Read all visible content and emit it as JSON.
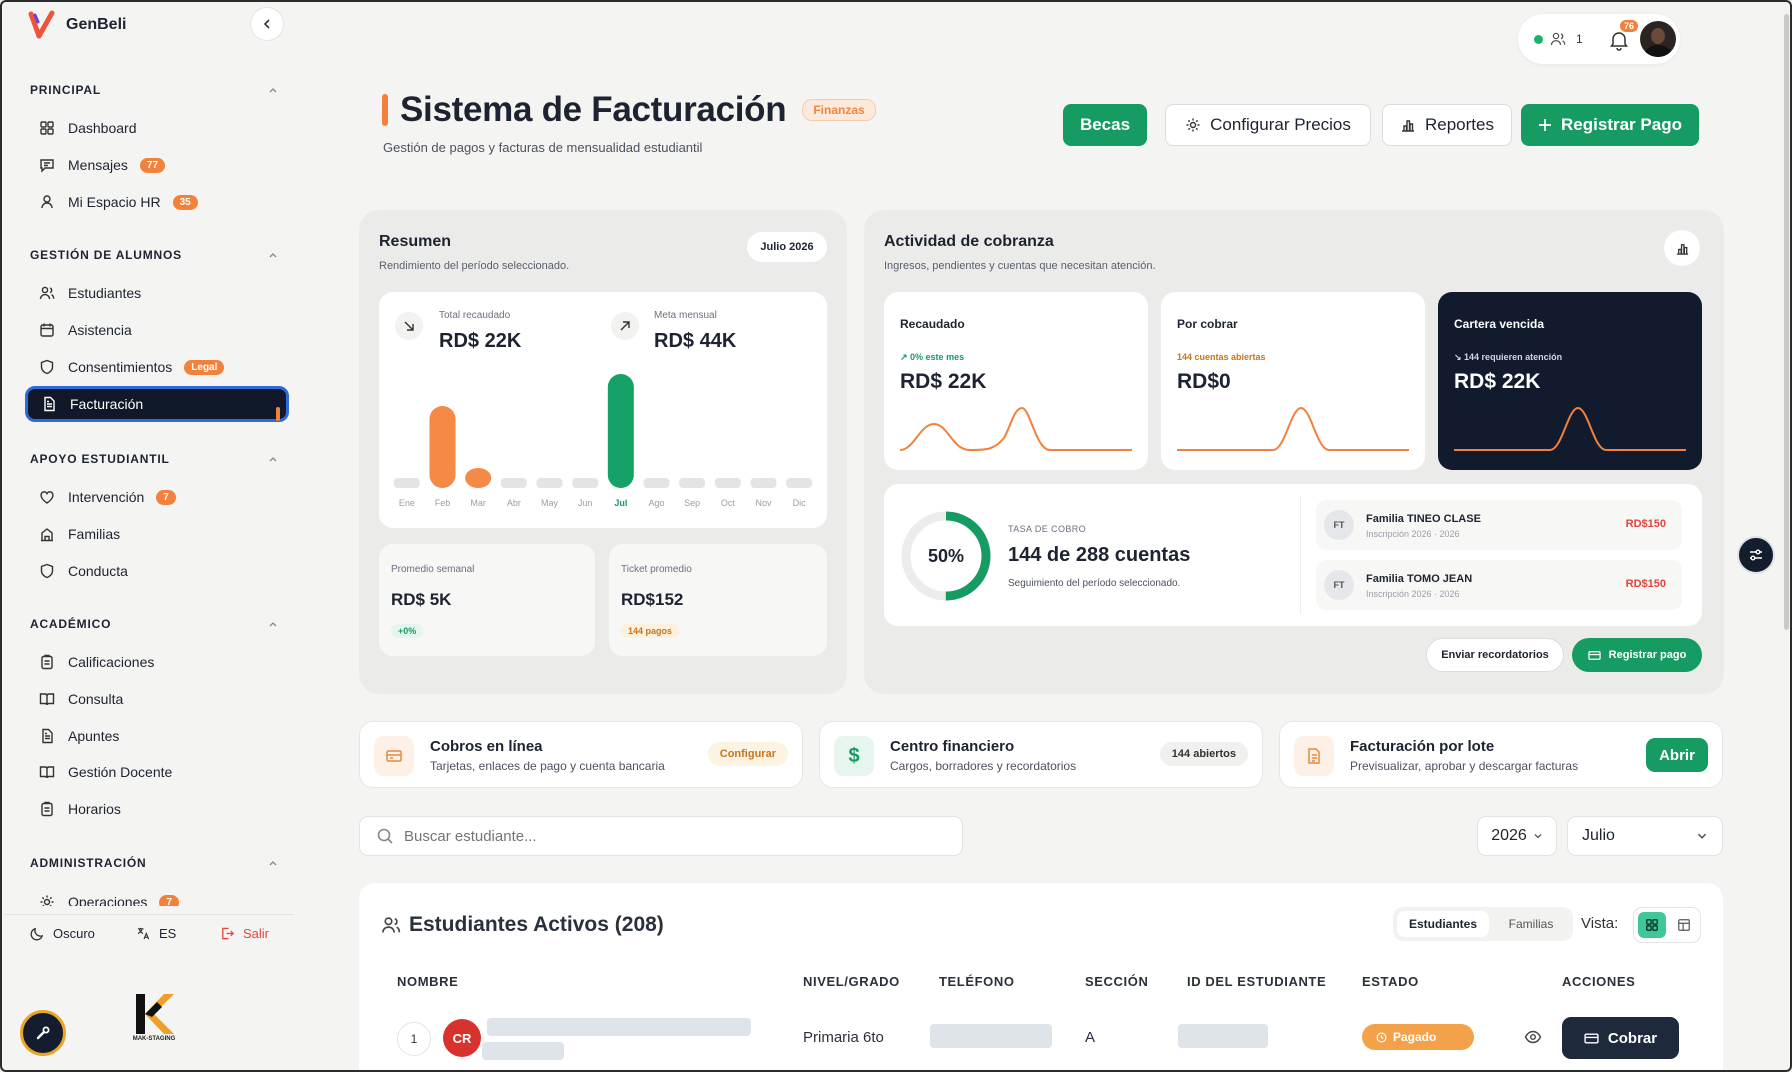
{
  "brand": {
    "name": "GenBeli"
  },
  "sidebar": {
    "sections": [
      {
        "title": "PRINCIPAL",
        "items": [
          {
            "label": "Dashboard",
            "icon": "grid-icon"
          },
          {
            "label": "Mensajes",
            "icon": "message-icon",
            "badge": "77"
          },
          {
            "label": "Mi Espacio HR",
            "icon": "user-icon",
            "badge": "35"
          }
        ]
      },
      {
        "title": "GESTIÓN DE ALUMNOS",
        "items": [
          {
            "label": "Estudiantes",
            "icon": "users-icon"
          },
          {
            "label": "Asistencia",
            "icon": "calendar-icon"
          },
          {
            "label": "Consentimientos",
            "icon": "shield-icon",
            "badge": "Legal"
          },
          {
            "label": "Facturación",
            "icon": "document-icon",
            "active": true
          }
        ]
      },
      {
        "title": "APOYO ESTUDIANTIL",
        "items": [
          {
            "label": "Intervención",
            "icon": "heart-icon",
            "badge": "7"
          },
          {
            "label": "Familias",
            "icon": "building-icon"
          },
          {
            "label": "Conducta",
            "icon": "shield-icon"
          }
        ]
      },
      {
        "title": "ACADÉMICO",
        "items": [
          {
            "label": "Calificaciones",
            "icon": "clipboard-icon"
          },
          {
            "label": "Consulta",
            "icon": "book-icon"
          },
          {
            "label": "Apuntes",
            "icon": "document-icon"
          },
          {
            "label": "Gestión Docente",
            "icon": "book-icon"
          },
          {
            "label": "Horarios",
            "icon": "clipboard-icon"
          }
        ]
      },
      {
        "title": "ADMINISTRACIÓN",
        "items": [
          {
            "label": "Operaciones",
            "icon": "gear-icon",
            "badge": "7"
          }
        ]
      }
    ],
    "footer": {
      "theme": "Oscuro",
      "lang": "ES",
      "logout": "Salir"
    },
    "studio": "MAK-STAGING"
  },
  "topbar": {
    "online_count": "1",
    "notifications": "76"
  },
  "header": {
    "title": "Sistema de Facturación",
    "tag": "Finanzas",
    "subtitle": "Gestión de pagos y facturas de mensualidad estudiantil",
    "buttons": {
      "becas": "Becas",
      "config": "Configurar Precios",
      "reportes": "Reportes",
      "registrar": "Registrar Pago"
    }
  },
  "resumen": {
    "title": "Resumen",
    "subtitle": "Rendimiento del período seleccionado.",
    "period": "Julio 2026",
    "total_label": "Total recaudado",
    "total_value": "RD$ 22K",
    "meta_label": "Meta mensual",
    "meta_value": "RD$ 44K",
    "promedio_label": "Promedio semanal",
    "promedio_value": "RD$ 5K",
    "promedio_delta": "+0%",
    "ticket_label": "Ticket promedio",
    "ticket_value": "RD$152",
    "ticket_count": "144 pagos"
  },
  "chart_data": {
    "type": "bar",
    "categories": [
      "Ene",
      "Feb",
      "Mar",
      "Abr",
      "May",
      "Jun",
      "Jul",
      "Ago",
      "Sep",
      "Oct",
      "Nov",
      "Dic"
    ],
    "values": [
      0,
      1,
      0.24,
      0,
      0,
      0,
      1.39,
      0,
      0,
      0,
      0,
      0
    ],
    "highlight": "Jul",
    "colors": {
      "bar": "#f48a46",
      "highlight": "#16a167",
      "empty": "#e4e4e2"
    },
    "title": "",
    "xlabel": "",
    "ylabel": ""
  },
  "actividad": {
    "title": "Actividad de cobranza",
    "subtitle": "Ingresos, pendientes y cuentas que necesitan atención.",
    "cards": [
      {
        "label": "Recaudado",
        "note": "↗ 0% este mes",
        "value": "RD$ 22K",
        "dark": false,
        "note_color": "#169b62"
      },
      {
        "label": "Por cobrar",
        "note": "144 cuentas abiertas",
        "value": "RD$0",
        "dark": false,
        "note_color": "#c9741d"
      },
      {
        "label": "Cartera vencida",
        "note": "↘ 144 requieren atención",
        "value": "RD$ 22K",
        "dark": true,
        "note_color": "#cfd5e2"
      }
    ],
    "tasa_pct": "50%",
    "tasa_value": 0.5,
    "tasa_label": "TASA DE COBRO",
    "tasa_text": "144 de 288 cuentas",
    "tasa_sub": "Seguimiento del período seleccionado.",
    "familias": [
      {
        "initials": "FT",
        "name": "Familia TINEO CLASE",
        "sub": "Inscripción 2026 · 2026",
        "amount": "RD$150"
      },
      {
        "initials": "FT",
        "name": "Familia TOMO JEAN",
        "sub": "Inscripción 2026 · 2026",
        "amount": "RD$150"
      }
    ],
    "recordatorios": "Enviar recordatorios",
    "registrar": "Registrar pago"
  },
  "features": [
    {
      "title": "Cobros en línea",
      "sub": "Tarjetas, enlaces de pago y cuenta bancaria",
      "action": "Configurar",
      "icon": "card-icon"
    },
    {
      "title": "Centro financiero",
      "sub": "Cargos, borradores y recordatorios",
      "action": "144 abiertos",
      "icon": "dollar-icon"
    },
    {
      "title": "Facturación por lote",
      "sub": "Previsualizar, aprobar y descargar facturas",
      "action": "Abrir",
      "icon": "file-icon"
    }
  ],
  "filters": {
    "search_placeholder": "Buscar estudiante...",
    "year": "2026",
    "month": "Julio"
  },
  "table": {
    "title": "Estudiantes Activos (208)",
    "tabs": [
      "Estudiantes",
      "Familias"
    ],
    "view_label": "Vista:",
    "columns": [
      "NOMBRE",
      "NIVEL/GRADO",
      "TELÉFONO",
      "SECCIÓN",
      "ID DEL ESTUDIANTE",
      "ESTADO",
      "ACCIONES"
    ],
    "rows": [
      {
        "index": "1",
        "initials": "CR",
        "grade": "Primaria 6to",
        "section": "A",
        "status": "Pagado",
        "action": "Cobrar"
      }
    ]
  }
}
